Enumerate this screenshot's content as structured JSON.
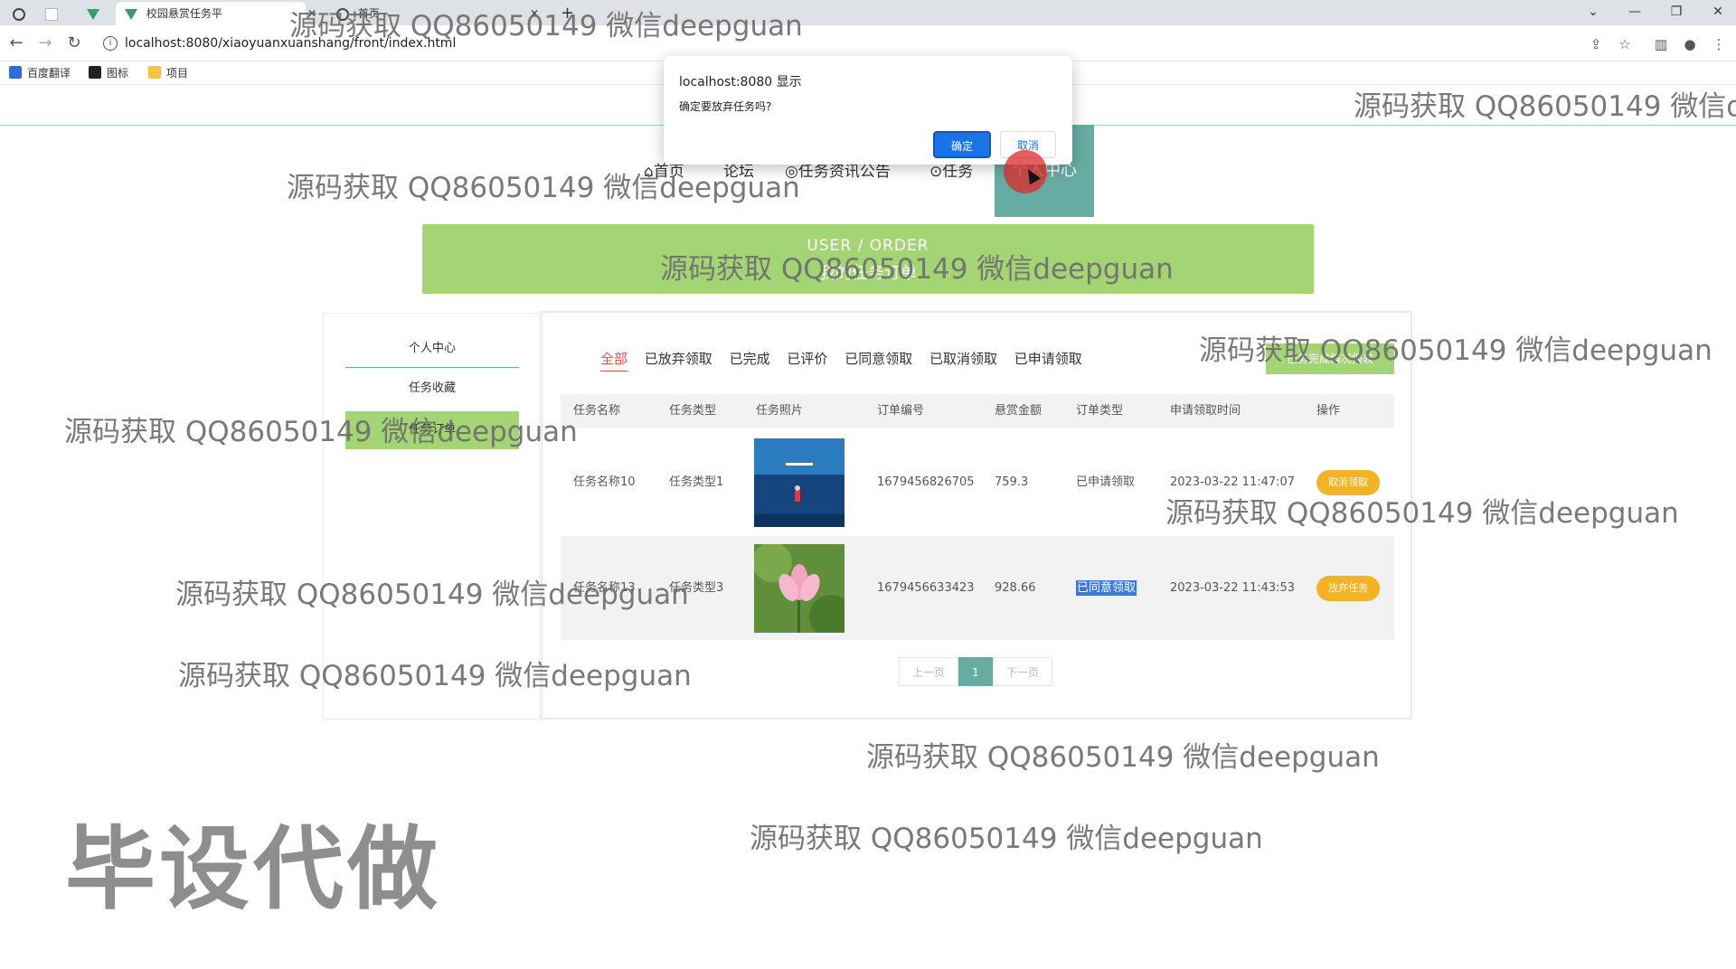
{
  "browser": {
    "tabs": [
      {
        "label": ""
      },
      {
        "label": ""
      },
      {
        "label": "校园悬赏任务平"
      },
      {
        "label": "首页"
      }
    ],
    "url": "localhost:8080/xiaoyuanxuanshang/front/index.html",
    "bookmarks": [
      "百度翻译",
      "图标",
      "项目"
    ]
  },
  "nav": {
    "items": [
      "首页",
      "论坛",
      "任务资讯公告",
      "任务"
    ],
    "personal": "个人中心"
  },
  "banner": {
    "en": "USER / ORDER",
    "cn": "我的任务订单"
  },
  "sidebar": {
    "items": [
      "个人中心",
      "任务收藏",
      "任务订单"
    ]
  },
  "tabs": [
    "全部",
    "已放弃领取",
    "已完成",
    "已评价",
    "已同意领取",
    "已取消领取",
    "已申请领取"
  ],
  "report_button": "任务完成情况报表",
  "table": {
    "headers": [
      "任务名称",
      "任务类型",
      "任务照片",
      "订单编号",
      "悬赏金额",
      "订单类型",
      "申请领取时间",
      "操作"
    ],
    "rows": [
      {
        "name": "任务名称10",
        "type": "任务类型1",
        "order_no": "1679456826705",
        "amount": "759.3",
        "order_type": "已申请领取",
        "time": "2023-03-22 11:47:07",
        "action": "取消领取"
      },
      {
        "name": "任务名称13",
        "type": "任务类型3",
        "order_no": "1679456633423",
        "amount": "928.66",
        "order_type": "已同意领取",
        "time": "2023-03-22 11:43:53",
        "action": "放弃任务"
      }
    ]
  },
  "pager": {
    "prev": "上一页",
    "current": "1",
    "next": "下一页"
  },
  "dialog": {
    "title": "localhost:8080 显示",
    "message": "确定要放弃任务吗?",
    "ok": "确定",
    "cancel": "取消"
  },
  "watermarks": {
    "text": "源码获取 QQ86050149 微信deepguan",
    "text_cut": "源码获取 QQ86050149 微信de",
    "big": "毕设代做"
  },
  "colors": {
    "accent_green": "#a3d575",
    "teal": "#67aca3",
    "button_orange": "#f3b324",
    "active_tab_red": "#d9534f"
  }
}
